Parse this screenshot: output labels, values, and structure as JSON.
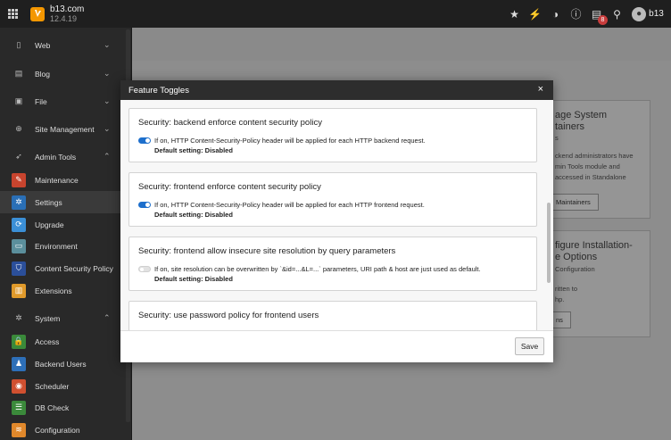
{
  "topbar": {
    "site_name": "b13.com",
    "version": "12.4.19",
    "notification_count": "8",
    "user": "b13",
    "icons": [
      "bookmark-icon",
      "flash-icon",
      "help-circle-icon",
      "question-icon",
      "system-info-icon",
      "search-icon",
      "user-avatar-icon"
    ]
  },
  "sidebar": {
    "items": [
      {
        "label": "Web",
        "icon": "page-icon",
        "chevron": "⌄"
      },
      {
        "label": "Blog",
        "icon": "blog-icon",
        "chevron": "⌄"
      },
      {
        "label": "File",
        "icon": "file-icon",
        "chevron": "⌄"
      },
      {
        "label": "Site Management",
        "icon": "site-icon",
        "chevron": "⌄"
      },
      {
        "label": "Admin Tools",
        "icon": "rocket-icon",
        "chevron": "⌃"
      },
      {
        "label": "Maintenance",
        "icon": "wrench-icon",
        "color": "#c8442e"
      },
      {
        "label": "Settings",
        "icon": "gear-icon",
        "color": "#2a6fb6"
      },
      {
        "label": "Upgrade",
        "icon": "upgrade-icon",
        "color": "#3b8fd6"
      },
      {
        "label": "Environment",
        "icon": "monitor-icon",
        "color": "#5b8f9c"
      },
      {
        "label": "Content Security Policy",
        "icon": "shield-icon",
        "color": "#2b4f9a"
      },
      {
        "label": "Extensions",
        "icon": "extension-icon",
        "color": "#e09a2b"
      },
      {
        "label": "System",
        "icon": "system-icon",
        "chevron": "⌃"
      },
      {
        "label": "Access",
        "icon": "lock-icon",
        "color": "#3a8a3a"
      },
      {
        "label": "Backend Users",
        "icon": "user-icon",
        "color": "#2d6fb8"
      },
      {
        "label": "Scheduler",
        "icon": "scheduler-icon",
        "color": "#d05030"
      },
      {
        "label": "DB Check",
        "icon": "database-icon",
        "color": "#3b8a3b"
      },
      {
        "label": "Configuration",
        "icon": "configuration-icon",
        "color": "#e0882b"
      }
    ]
  },
  "background": {
    "card1": {
      "title_lines": [
        "age System",
        "tainers"
      ],
      "suffix": "s",
      "body_lines": [
        "ckend administrators have",
        "min Tools module and",
        "accessed in Standalone"
      ],
      "button": "Maintainers"
    },
    "card2": {
      "title_lines": [
        "figure Installation-",
        "e Options"
      ],
      "sub": "Configuration",
      "body_lines": [
        "ritten to",
        "hp."
      ],
      "button": "ns"
    }
  },
  "modal": {
    "title": "Feature Toggles",
    "close": "×",
    "toggles": [
      {
        "title": "Security: backend enforce content security policy",
        "enabled": true,
        "description": "If on, HTTP Content-Security-Policy header will be applied for each HTTP backend request.",
        "default": "Default setting: Disabled"
      },
      {
        "title": "Security: frontend enforce content security policy",
        "enabled": true,
        "description": "If on, HTTP Content-Security-Policy header will be applied for each HTTP frontend request.",
        "default": "Default setting: Disabled"
      },
      {
        "title": "Security: frontend allow insecure site resolution by query parameters",
        "enabled": false,
        "description": "If on, site resolution can be overwritten by `&id=...&L=...` parameters, URI path & host are just used as default.",
        "default": "Default setting: Disabled"
      },
      {
        "title": "Security: use password policy for frontend users",
        "enabled": true,
        "description": "",
        "default": ""
      }
    ],
    "save_label": "Save"
  }
}
